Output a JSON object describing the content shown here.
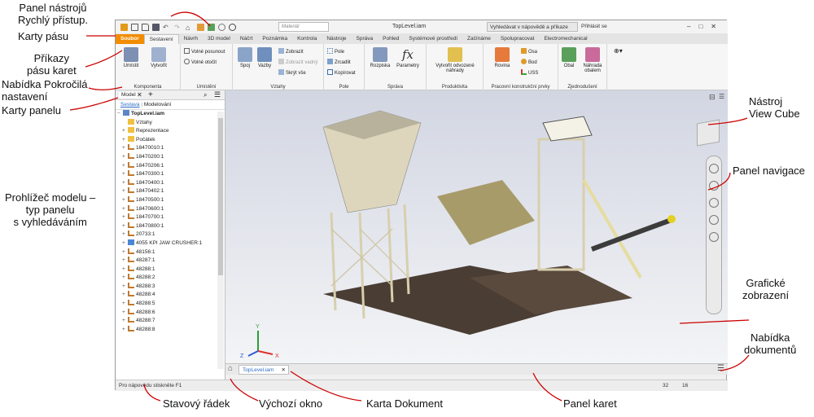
{
  "annotations": {
    "qat": [
      "Panel nástrojů",
      "Rychlý přístup."
    ],
    "ribbon_tabs": "Karty pásu",
    "ribbon_commands": [
      "Příkazy",
      "pásu karet"
    ],
    "advanced_menu": [
      "Nabídka Pokročilá",
      "nastavení"
    ],
    "panel_tabs": "Karty panelu",
    "model_browser": [
      "Prohlížeč modelu –",
      "typ panelu",
      "s vyhledáváním"
    ],
    "view_cube": [
      "Nástroj",
      "View Cube"
    ],
    "nav_bar": "Panel navigace",
    "graphics": [
      "Grafické",
      "zobrazení"
    ],
    "doc_menu": [
      "Nabídka",
      "dokumentů"
    ],
    "status_bar": "Stavový řádek",
    "home_window": "Výchozí okno",
    "doc_tab": "Karta Dokument",
    "tab_bar": "Panel karet"
  },
  "titlebar": {
    "doc_title": "TopLevel.iam",
    "material_placeholder": "Materiál",
    "help_search": "Vyhledávat v nápovědě a příkaze",
    "sign_in": "Přihlásit se"
  },
  "tabs": [
    "Soubor",
    "Sestavení",
    "Návrh",
    "3D model",
    "Náčrt",
    "Poznámka",
    "Kontrola",
    "Nástroje",
    "Správa",
    "Pohled",
    "Systémové prostředí",
    "Začínáme",
    "Spolupracovat",
    "Electromechanical"
  ],
  "ribbon": {
    "komponenta": {
      "title": "Komponenta",
      "umistit": "Umístit",
      "vytvorit": "Vytvořit"
    },
    "umisteni": {
      "title": "Umístění",
      "volne_posunout": "Volné posunout",
      "volne_otocit": "Volné otočit"
    },
    "vztahy": {
      "title": "Vztahy",
      "spoj": "Spoj",
      "vazby": "Vazby",
      "zobrazit": "Zobrazit",
      "zobrazit_vadny": "Zobrazit vadný",
      "skryt_vse": "Skrýt vše"
    },
    "pole": {
      "title": "Pole",
      "pole": "Pole",
      "zrcadlit": "Zrcadlit",
      "kopirovat": "Kopírovat"
    },
    "sprava": {
      "title": "Správa",
      "rozpiska": "Rozpiska",
      "parametry": "Parametry"
    },
    "produktivita": {
      "title": "Produktivita",
      "vytvorit_nahrady": "Vytvořit odvozené náhrady"
    },
    "prk": {
      "title": "Pracovní konstrukční prvky",
      "rovina": "Rovina",
      "osa": "Osa",
      "bod": "Bod",
      "uss": "USS"
    },
    "zjednoduseni": {
      "title": "Zjednodušení",
      "obal": "Obal",
      "nahrada_obalem": "Náhrada obalem"
    }
  },
  "browser": {
    "title": "Model",
    "sub_active": "Sestava",
    "sub_other": "Modelování",
    "items": [
      {
        "label": "TopLevel.iam",
        "kind": "root"
      },
      {
        "label": "Vztahy",
        "kind": "folder"
      },
      {
        "label": "Reprezentace",
        "kind": "folder"
      },
      {
        "label": "Počátek",
        "kind": "folder"
      },
      {
        "label": "18470010:1",
        "kind": "part"
      },
      {
        "label": "18470200:1",
        "kind": "part"
      },
      {
        "label": "18470206:1",
        "kind": "part"
      },
      {
        "label": "18470300:1",
        "kind": "part"
      },
      {
        "label": "18470400:1",
        "kind": "part"
      },
      {
        "label": "18470402:1",
        "kind": "part"
      },
      {
        "label": "18470500:1",
        "kind": "part"
      },
      {
        "label": "18470600:1",
        "kind": "part"
      },
      {
        "label": "18470700:1",
        "kind": "part"
      },
      {
        "label": "18470800:1",
        "kind": "part"
      },
      {
        "label": "20733:1",
        "kind": "part"
      },
      {
        "label": "4055 KPI JAW CRUSHER:1",
        "kind": "asm"
      },
      {
        "label": "48156:1",
        "kind": "part"
      },
      {
        "label": "48287:1",
        "kind": "part"
      },
      {
        "label": "48288:1",
        "kind": "part"
      },
      {
        "label": "48288:2",
        "kind": "part"
      },
      {
        "label": "48288:3",
        "kind": "part"
      },
      {
        "label": "48288:4",
        "kind": "part"
      },
      {
        "label": "48288:5",
        "kind": "part"
      },
      {
        "label": "48288:6",
        "kind": "part"
      },
      {
        "label": "48288:7",
        "kind": "part"
      },
      {
        "label": "48288:8",
        "kind": "part"
      }
    ]
  },
  "axes": {
    "x": "X",
    "y": "Y",
    "z": "Z"
  },
  "doc_tab": "TopLevel.iam",
  "status": {
    "text": "Pro nápovědu stiskněte F1",
    "n1": "32",
    "n2": "16"
  }
}
